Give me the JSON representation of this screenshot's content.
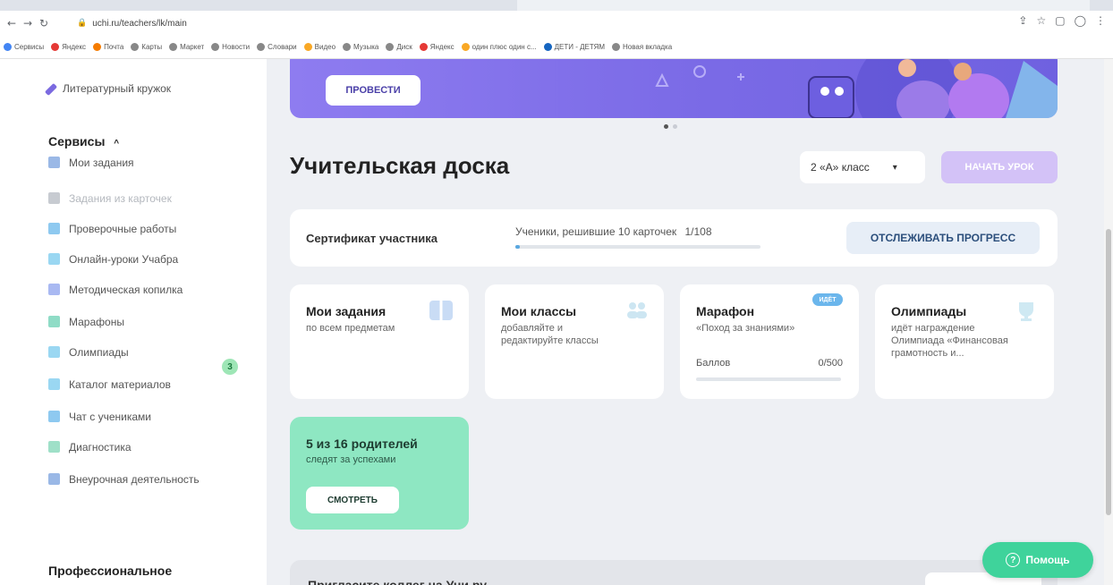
{
  "browser": {
    "url": "uchi.ru/teachers/lk/main",
    "bookmarks": [
      {
        "label": "Сервисы",
        "color": "#4285f4"
      },
      {
        "label": "Яндекс",
        "color": "#e53935"
      },
      {
        "label": "Почта",
        "color": "#f57c00"
      },
      {
        "label": "Карты",
        "color": "#888888"
      },
      {
        "label": "Маркет",
        "color": "#888888"
      },
      {
        "label": "Новости",
        "color": "#888888"
      },
      {
        "label": "Словари",
        "color": "#888888"
      },
      {
        "label": "Видео",
        "color": "#f9a825"
      },
      {
        "label": "Музыка",
        "color": "#888888"
      },
      {
        "label": "Диск",
        "color": "#888888"
      },
      {
        "label": "Яндекс",
        "color": "#e53935"
      },
      {
        "label": "один плюс один с...",
        "color": "#f9a825"
      },
      {
        "label": "ДЕТИ - ДЕТЯМ",
        "color": "#1565c0"
      },
      {
        "label": "Новая вкладка",
        "color": "#888888"
      }
    ]
  },
  "sidebar": {
    "top_item": "Литературный кружок",
    "services_title": "Сервисы",
    "items": [
      {
        "label": "Мои задания",
        "color": "#9ab8e6"
      },
      {
        "label": "Задания из карточек",
        "color": "#c7cbd1"
      },
      {
        "label": "Проверочные работы",
        "color": "#8ec9f0"
      },
      {
        "label": "Онлайн-уроки Учабра",
        "color": "#9ad7f2"
      },
      {
        "label": "Методическая копилка",
        "color": "#a9b9f2"
      },
      {
        "label": "Марафоны",
        "color": "#8fdcc6"
      },
      {
        "label": "Олимпиады",
        "color": "#9ad7f2"
      },
      {
        "label": "Каталог материалов",
        "color": "#9ad7f2"
      },
      {
        "label": "Чат с учениками",
        "color": "#8ec9f0"
      },
      {
        "label": "Диагностика",
        "color": "#9fe0c8"
      },
      {
        "label": "Внеурочная деятельность",
        "color": "#9ab8e6"
      }
    ],
    "olympiad_badge": "3",
    "professional_title": "Профессиональное развитие"
  },
  "main": {
    "banner_button": "ПРОВЕСТИ",
    "title": "Учительская доска",
    "class_select": "2 «А» класс",
    "start_button": "НАЧАТЬ УРОК",
    "certificate": {
      "label": "Сертификат участника",
      "progress_text": "Ученики, решившие 10 карточек",
      "progress_value": "1/108",
      "progress_fraction": 0.01,
      "button": "ОТСЛЕЖИВАТЬ ПРОГРЕСС"
    },
    "cards": [
      {
        "title": "Мои задания",
        "subtitle": "по всем предметам"
      },
      {
        "title": "Мои классы",
        "subtitle": "добавляйте и редактируйте классы"
      },
      {
        "title": "Марафон",
        "subtitle": "«Поход за знаниями»",
        "badge": "ИДЁТ",
        "score_label": "Баллов",
        "score_value": "0/500"
      },
      {
        "title": "Олимпиады",
        "subtitle": "идёт награждение Олимпиада «Финансовая грамотность и..."
      }
    ],
    "parents": {
      "title": "5 из 16 родителей",
      "subtitle": "следят за успехами",
      "button": "СМОТРЕТЬ"
    },
    "invite_title": "Пригласите коллег на Учи.ру",
    "help_button": "Помощь"
  }
}
